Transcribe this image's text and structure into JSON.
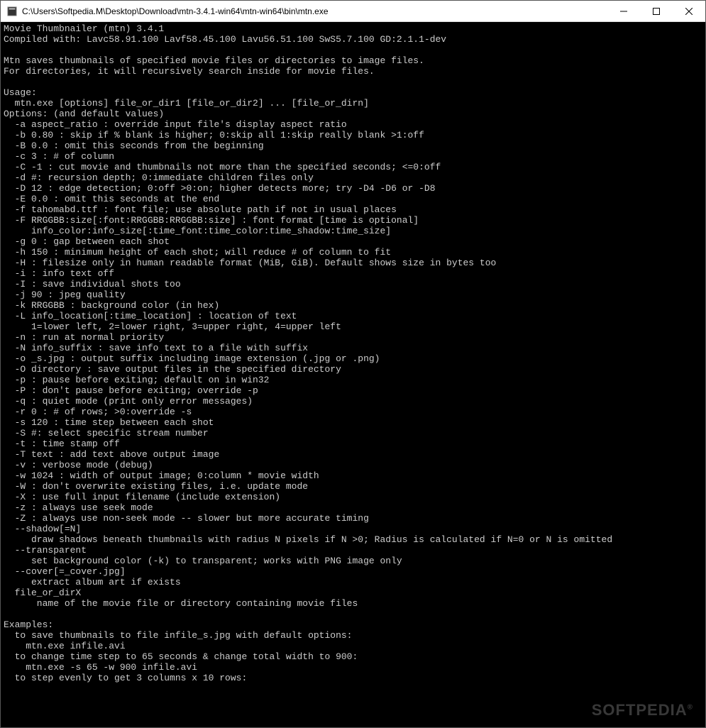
{
  "window": {
    "title": "C:\\Users\\Softpedia.M\\Desktop\\Download\\mtn-3.4.1-win64\\mtn-win64\\bin\\mtn.exe"
  },
  "terminal": {
    "lines": [
      "Movie Thumbnailer (mtn) 3.4.1",
      "Compiled with: Lavc58.91.100 Lavf58.45.100 Lavu56.51.100 SwS5.7.100 GD:2.1.1-dev",
      "",
      "Mtn saves thumbnails of specified movie files or directories to image files.",
      "For directories, it will recursively search inside for movie files.",
      "",
      "Usage:",
      "  mtn.exe [options] file_or_dir1 [file_or_dir2] ... [file_or_dirn]",
      "Options: (and default values)",
      "  -a aspect_ratio : override input file's display aspect ratio",
      "  -b 0.80 : skip if % blank is higher; 0:skip all 1:skip really blank >1:off",
      "  -B 0.0 : omit this seconds from the beginning",
      "  -c 3 : # of column",
      "  -C -1 : cut movie and thumbnails not more than the specified seconds; <=0:off",
      "  -d #: recursion depth; 0:immediate children files only",
      "  -D 12 : edge detection; 0:off >0:on; higher detects more; try -D4 -D6 or -D8",
      "  -E 0.0 : omit this seconds at the end",
      "  -f tahomabd.ttf : font file; use absolute path if not in usual places",
      "  -F RRGGBB:size[:font:RRGGBB:RRGGBB:size] : font format [time is optional]",
      "     info_color:info_size[:time_font:time_color:time_shadow:time_size]",
      "  -g 0 : gap between each shot",
      "  -h 150 : minimum height of each shot; will reduce # of column to fit",
      "  -H : filesize only in human readable format (MiB, GiB). Default shows size in bytes too",
      "  -i : info text off",
      "  -I : save individual shots too",
      "  -j 90 : jpeg quality",
      "  -k RRGGBB : background color (in hex)",
      "  -L info_location[:time_location] : location of text",
      "     1=lower left, 2=lower right, 3=upper right, 4=upper left",
      "  -n : run at normal priority",
      "  -N info_suffix : save info text to a file with suffix",
      "  -o _s.jpg : output suffix including image extension (.jpg or .png)",
      "  -O directory : save output files in the specified directory",
      "  -p : pause before exiting; default on in win32",
      "  -P : don't pause before exiting; override -p",
      "  -q : quiet mode (print only error messages)",
      "  -r 0 : # of rows; >0:override -s",
      "  -s 120 : time step between each shot",
      "  -S #: select specific stream number",
      "  -t : time stamp off",
      "  -T text : add text above output image",
      "  -v : verbose mode (debug)",
      "  -w 1024 : width of output image; 0:column * movie width",
      "  -W : don't overwrite existing files, i.e. update mode",
      "  -X : use full input filename (include extension)",
      "  -z : always use seek mode",
      "  -Z : always use non-seek mode -- slower but more accurate timing",
      "  --shadow[=N]",
      "     draw shadows beneath thumbnails with radius N pixels if N >0; Radius is calculated if N=0 or N is omitted",
      "  --transparent",
      "     set background color (-k) to transparent; works with PNG image only",
      "  --cover[=_cover.jpg]",
      "     extract album art if exists",
      "  file_or_dirX",
      "      name of the movie file or directory containing movie files",
      "",
      "Examples:",
      "  to save thumbnails to file infile_s.jpg with default options:",
      "    mtn.exe infile.avi",
      "  to change time step to 65 seconds & change total width to 900:",
      "    mtn.exe -s 65 -w 900 infile.avi",
      "  to step evenly to get 3 columns x 10 rows:"
    ]
  },
  "watermark": {
    "text": "SOFTPEDIA"
  }
}
